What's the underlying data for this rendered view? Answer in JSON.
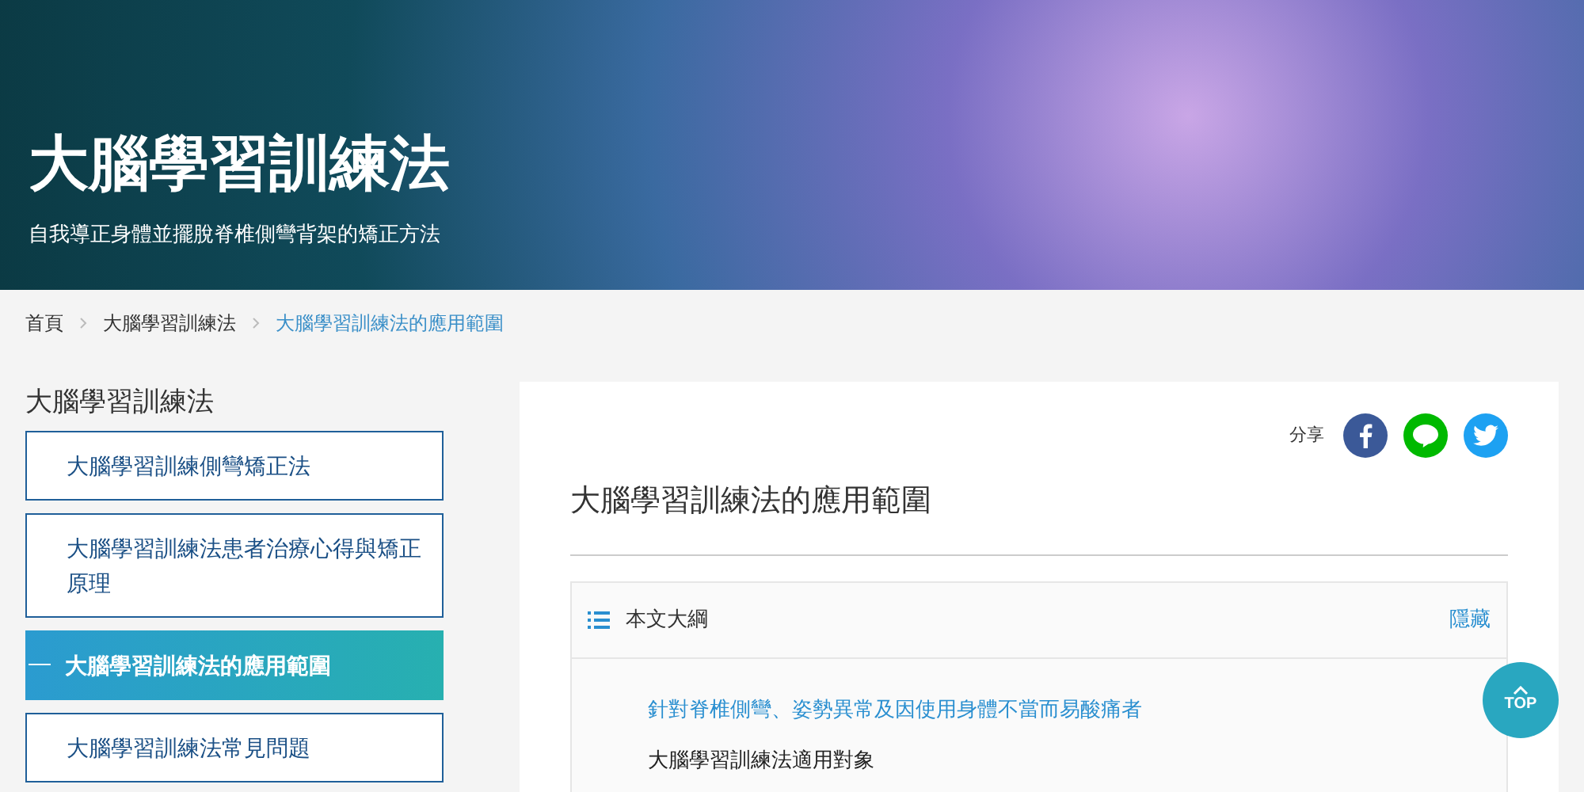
{
  "hero": {
    "title": "大腦學習訓練法",
    "subtitle": "自我導正身體並擺脫脊椎側彎背架的矯正方法"
  },
  "breadcrumb": [
    {
      "label": "首頁",
      "selected": false
    },
    {
      "label": "大腦學習訓練法",
      "selected": false
    },
    {
      "label": "大腦學習訓練法的應用範圍",
      "selected": true
    }
  ],
  "sidebar": {
    "title": "大腦學習訓練法",
    "items": [
      {
        "label": "大腦學習訓練側彎矯正法",
        "selected": false
      },
      {
        "label": "大腦學習訓練法患者治療心得與矯正原理",
        "selected": false
      },
      {
        "label": "大腦學習訓練法的應用範圍",
        "selected": true
      },
      {
        "label": "大腦學習訓練法常見問題",
        "selected": false
      }
    ]
  },
  "article": {
    "share_label": "分享",
    "title": "大腦學習訓練法的應用範圍",
    "toc": {
      "title": "本文大綱",
      "toggle": "隱藏",
      "items": [
        {
          "label": "針對脊椎側彎、姿勢異常及因使用身體不當而易酸痛者",
          "selected": true
        },
        {
          "label": "大腦學習訓練法適用對象",
          "selected": false
        }
      ]
    }
  },
  "top_button": {
    "label": "TOP"
  }
}
